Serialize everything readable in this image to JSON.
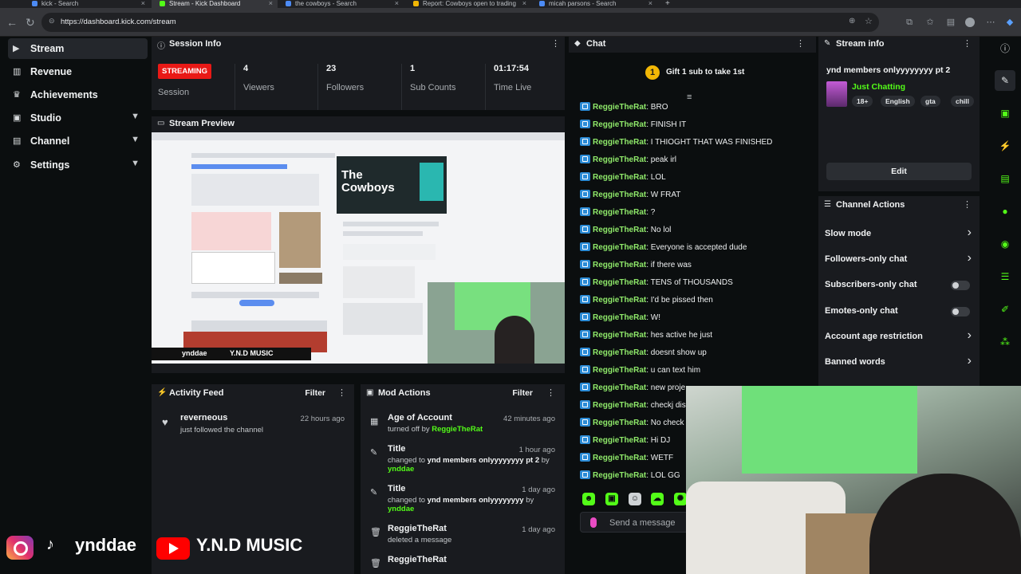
{
  "browser": {
    "tabs": [
      {
        "label": "kick - Search",
        "color": "#4c8bf5",
        "active": false
      },
      {
        "label": "Stream - Kick Dashboard",
        "color": "#53fc18",
        "active": true
      },
      {
        "label": "the cowboys - Search",
        "color": "#4c8bf5",
        "active": false
      },
      {
        "label": "Report: Cowboys open to trading",
        "color": "#f2b705",
        "active": false
      },
      {
        "label": "micah parsons - Search",
        "color": "#4c8bf5",
        "active": false
      }
    ],
    "url": "https://dashboard.kick.com/stream"
  },
  "sidebar": {
    "items": [
      {
        "label": "Stream",
        "icon": "stream-icon",
        "glyph": "▶",
        "chevron": false
      },
      {
        "label": "Revenue",
        "icon": "chart-icon",
        "glyph": "▥",
        "chevron": false
      },
      {
        "label": "Achievements",
        "icon": "trophy-icon",
        "glyph": "♛",
        "chevron": false
      },
      {
        "label": "Studio",
        "icon": "studio-icon",
        "glyph": "▣",
        "chevron": true
      },
      {
        "label": "Channel",
        "icon": "channel-icon",
        "glyph": "▤",
        "chevron": true
      },
      {
        "label": "Settings",
        "icon": "gear-icon",
        "glyph": "⚙",
        "chevron": true
      }
    ]
  },
  "session_info": {
    "title": "Session Info",
    "badge": "STREAMING",
    "session_label": "Session",
    "stats": [
      {
        "value": "4",
        "label": "Viewers"
      },
      {
        "value": "23",
        "label": "Followers"
      },
      {
        "value": "1",
        "label": "Sub Counts"
      },
      {
        "value": "01:17:54",
        "label": "Time Live"
      }
    ]
  },
  "stream_preview": {
    "title": "Stream Preview",
    "card_title": "The Cowboys",
    "overlay_handle": "ynddae",
    "overlay_music": "Y.N.D MUSIC"
  },
  "activity_feed": {
    "title": "Activity Feed",
    "filter_label": "Filter",
    "items": [
      {
        "name": "reverneous",
        "text": "just followed the channel",
        "time": "22 hours ago"
      }
    ]
  },
  "mod_actions": {
    "title": "Mod Actions",
    "filter_label": "Filter",
    "items": [
      {
        "title": "Age of Account",
        "prefix": "turned off by",
        "user": "ReggieTheRat",
        "value": "",
        "suffix": "",
        "time": "42 minutes ago",
        "icon": "calendar-icon",
        "glyph": "▦"
      },
      {
        "title": "Title",
        "prefix": "changed to",
        "value": "ynd members onlyyyyyyyy pt 2",
        "suffix": "by",
        "user": "ynddae",
        "time": "1 hour ago",
        "icon": "user-edit-icon",
        "glyph": "✎"
      },
      {
        "title": "Title",
        "prefix": "changed to",
        "value": "ynd members onlyyyyyyyy",
        "suffix": "by",
        "user": "ynddae",
        "time": "1 day ago",
        "icon": "user-edit-icon",
        "glyph": "✎"
      },
      {
        "title": "ReggieTheRat",
        "prefix": "deleted a message",
        "value": "",
        "suffix": "",
        "user": "",
        "time": "1 day ago",
        "icon": "trash-icon",
        "glyph": "🗑"
      },
      {
        "title": "ReggieTheRat",
        "prefix": "",
        "value": "",
        "suffix": "",
        "user": "",
        "time": "",
        "icon": "trash-icon",
        "glyph": "🗑"
      }
    ]
  },
  "chat": {
    "title": "Chat",
    "gift_count": "1",
    "gift_text": "Gift 1 sub to take 1st",
    "messages": [
      {
        "user": "ReggieTheRat",
        "text": "BRO"
      },
      {
        "user": "ReggieTheRat",
        "text": "FINISH IT"
      },
      {
        "user": "ReggieTheRat",
        "text": "I THIOGHT THAT WAS FINISHED"
      },
      {
        "user": "ReggieTheRat",
        "text": "peak irl"
      },
      {
        "user": "ReggieTheRat",
        "text": "LOL"
      },
      {
        "user": "ReggieTheRat",
        "text": "W FRAT"
      },
      {
        "user": "ReggieTheRat",
        "text": "?"
      },
      {
        "user": "ReggieTheRat",
        "text": "No lol"
      },
      {
        "user": "ReggieTheRat",
        "text": "Everyone is accepted dude"
      },
      {
        "user": "ReggieTheRat",
        "text": "if there was"
      },
      {
        "user": "ReggieTheRat",
        "text": "TENS of THOUSANDS"
      },
      {
        "user": "ReggieTheRat",
        "text": "I'd be pissed then"
      },
      {
        "user": "ReggieTheRat",
        "text": "W!"
      },
      {
        "user": "ReggieTheRat",
        "text": "hes active he just"
      },
      {
        "user": "ReggieTheRat",
        "text": "doesnt show up"
      },
      {
        "user": "ReggieTheRat",
        "text": "u can text him"
      },
      {
        "user": "ReggieTheRat",
        "text": "new proje"
      },
      {
        "user": "ReggieTheRat",
        "text": "checkj disc"
      },
      {
        "user": "ReggieTheRat",
        "text": "No check c"
      },
      {
        "user": "ReggieTheRat",
        "text": "Hi DJ"
      },
      {
        "user": "ReggieTheRat",
        "text": "WETF"
      },
      {
        "user": "ReggieTheRat",
        "text": "LOL GG"
      }
    ],
    "input_placeholder": "Send a message"
  },
  "stream_info": {
    "title": "Stream info",
    "stream_title": "ynd members onlyyyyyyyy pt 2",
    "category": "Just Chatting",
    "tags": [
      "18+",
      "English",
      "gta",
      "chill"
    ],
    "edit_label": "Edit"
  },
  "channel_actions": {
    "title": "Channel Actions",
    "items": [
      {
        "label": "Slow mode",
        "control": "chevron"
      },
      {
        "label": "Followers-only chat",
        "control": "chevron"
      },
      {
        "label": "Subscribers-only chat",
        "control": "toggle"
      },
      {
        "label": "Emotes-only chat",
        "control": "toggle"
      },
      {
        "label": "Account age restriction",
        "control": "chevron"
      },
      {
        "label": "Banned words",
        "control": "chevron"
      }
    ]
  },
  "rail": {
    "icons": [
      "info-icon",
      "pencil-icon",
      "qr-icon",
      "bolt-icon",
      "clipboard-icon",
      "chat-bubble-icon",
      "broadcast-icon",
      "server-icon",
      "wrench-icon",
      "nodes-icon"
    ]
  },
  "colors": {
    "accent": "#53fc18",
    "live": "#e91916",
    "panel": "#191b1f",
    "bg": "#0b0e0f"
  }
}
